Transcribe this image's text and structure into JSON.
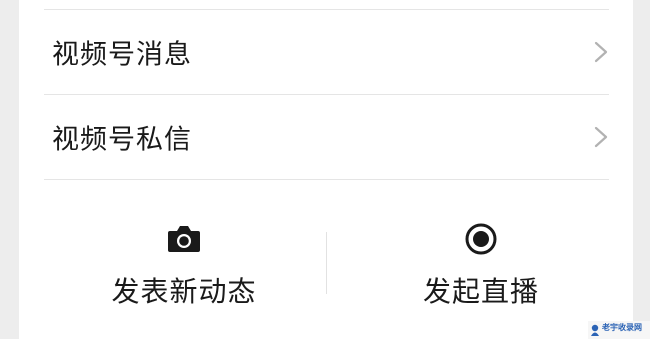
{
  "menu": {
    "items": [
      {
        "label": "视频号消息",
        "icon": "chevron-right-icon"
      },
      {
        "label": "视频号私信",
        "icon": "chevron-right-icon"
      }
    ]
  },
  "actions": {
    "post": {
      "label": "发表新动态",
      "icon": "camera-icon"
    },
    "live": {
      "label": "发起直播",
      "icon": "live-record-icon"
    }
  },
  "watermark": {
    "text": "老宇收录网"
  },
  "colors": {
    "background": "#ededed",
    "panel": "#ffffff",
    "text": "#1a1a1a",
    "chevron": "#b2b2b2",
    "separator": "#e5e5e5"
  }
}
